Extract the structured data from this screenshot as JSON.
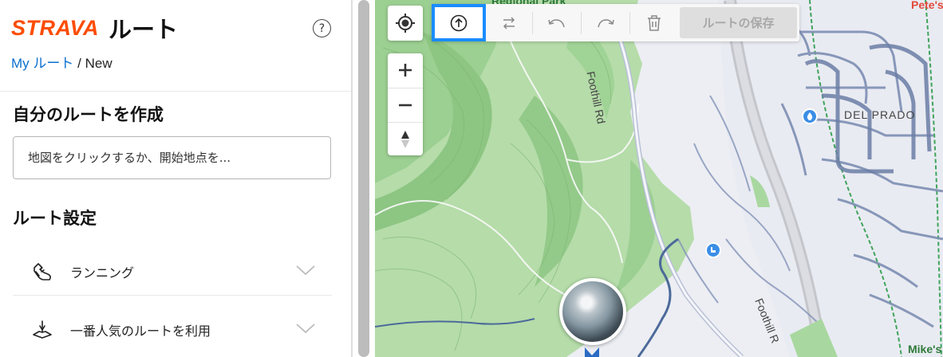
{
  "header": {
    "logo": "STRAVA",
    "title": "ルート",
    "help_glyph": "?"
  },
  "breadcrumb": {
    "link": "My ルート",
    "separator": "/",
    "current": "New"
  },
  "create": {
    "heading": "自分のルートを作成",
    "search_placeholder": "地図をクリックするか、開始地点を..."
  },
  "settings": {
    "heading": "ルート設定",
    "options": [
      {
        "label": "ランニング",
        "icon": "running-shoe-icon"
      },
      {
        "label": "一番人気のルートを利用",
        "icon": "popularity-routing-icon"
      }
    ]
  },
  "toolbar": {
    "save_label": "ルートの保存",
    "buttons": [
      "upload-icon",
      "reverse-route-icon",
      "undo-icon",
      "redo-icon",
      "trash-icon"
    ]
  },
  "map": {
    "labels": {
      "park": "Regional Park",
      "road1": "Foothill Rd",
      "road2": "Foothill R",
      "neighborhood": "DEL PRADO",
      "poi_top": "Pete's",
      "poi_bottom": "Mike's"
    },
    "colors": {
      "park_green": "#a8d8a0",
      "road_blue": "#7d8fb3",
      "accent_orange": "#fc4c02",
      "highlight_blue": "#1a8cff"
    }
  }
}
